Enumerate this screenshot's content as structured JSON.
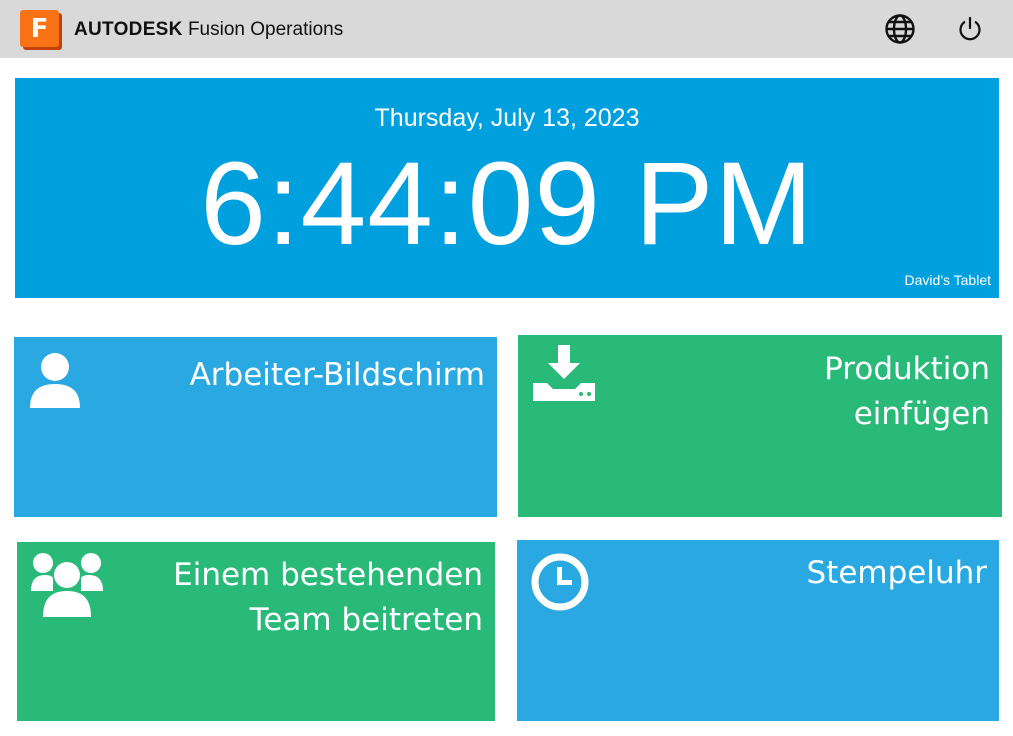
{
  "header": {
    "brand_strong": "AUTODESK",
    "brand_light": "Fusion Operations",
    "logo_letter": "F",
    "icons": [
      "globe-icon",
      "power-icon"
    ]
  },
  "clock": {
    "date": "Thursday, July 13, 2023",
    "time": "6:44:09 PM",
    "device": "David's Tablet"
  },
  "tiles": [
    {
      "label": "Arbeiter-Bildschirm",
      "icon": "user-icon",
      "color": "#29a8e1"
    },
    {
      "label": "Produktion einfügen",
      "icon": "download-tray-icon",
      "color": "#29b978"
    },
    {
      "label": "Einem bestehenden Team beitreten",
      "icon": "team-icon",
      "color": "#29b978"
    },
    {
      "label": "Stempeluhr",
      "icon": "clock-icon",
      "color": "#29a8e1"
    }
  ],
  "colors": {
    "topbar": "#d9d9d9",
    "clock_panel": "#00a0df",
    "brand_orange": "#f97316"
  }
}
